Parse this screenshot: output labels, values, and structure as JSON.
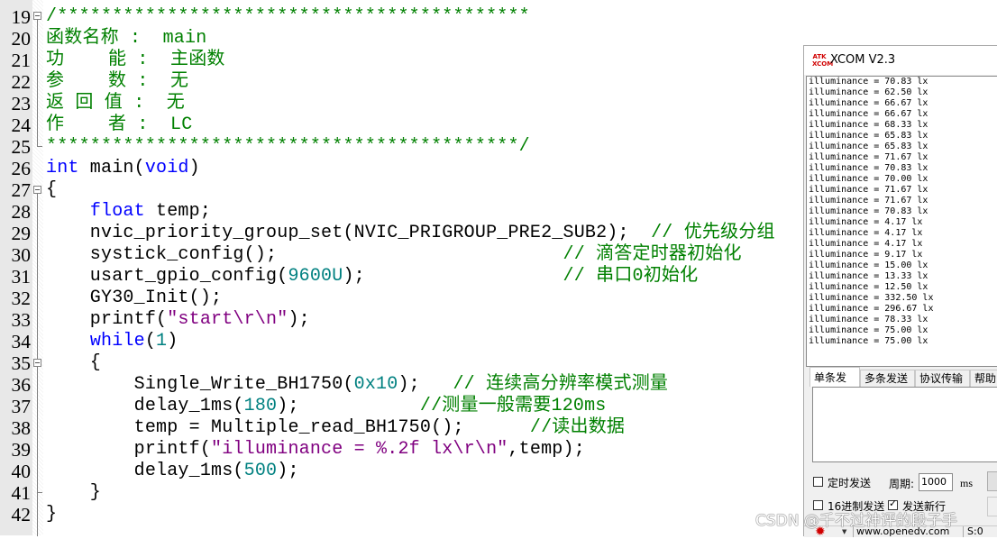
{
  "editor": {
    "lines": [
      {
        "num": "19",
        "parts": [
          {
            "t": "/*******************************************",
            "c": "cmt"
          }
        ]
      },
      {
        "num": "20",
        "parts": [
          {
            "t": "函数名称 :  main",
            "c": "cmt"
          }
        ]
      },
      {
        "num": "21",
        "parts": [
          {
            "t": "功    能 :  主函数",
            "c": "cmt"
          }
        ]
      },
      {
        "num": "22",
        "parts": [
          {
            "t": "参    数 :  无",
            "c": "cmt"
          }
        ]
      },
      {
        "num": "23",
        "parts": [
          {
            "t": "返 回 值 :  无",
            "c": "cmt"
          }
        ]
      },
      {
        "num": "24",
        "parts": [
          {
            "t": "作    者 :  LC",
            "c": "cmt"
          }
        ]
      },
      {
        "num": "25",
        "parts": [
          {
            "t": "*******************************************/",
            "c": "cmt"
          }
        ]
      },
      {
        "num": "26",
        "parts": [
          {
            "t": "int",
            "c": "kw"
          },
          {
            "t": " main(",
            "c": ""
          },
          {
            "t": "void",
            "c": "kw"
          },
          {
            "t": ")",
            "c": ""
          }
        ]
      },
      {
        "num": "27",
        "parts": [
          {
            "t": "{",
            "c": ""
          }
        ]
      },
      {
        "num": "28",
        "parts": [
          {
            "t": "    ",
            "c": ""
          },
          {
            "t": "float",
            "c": "kw"
          },
          {
            "t": " temp;",
            "c": ""
          }
        ]
      },
      {
        "num": "29",
        "parts": [
          {
            "t": "    nvic_priority_group_set(NVIC_PRIGROUP_PRE2_SUB2);  ",
            "c": ""
          },
          {
            "t": "// 优先级分组",
            "c": "cmt"
          }
        ]
      },
      {
        "num": "30",
        "parts": [
          {
            "t": "    systick_config();                          ",
            "c": ""
          },
          {
            "t": "// 滴答定时器初始化",
            "c": "cmt"
          }
        ]
      },
      {
        "num": "31",
        "parts": [
          {
            "t": "    usart_gpio_config(",
            "c": ""
          },
          {
            "t": "9600U",
            "c": "num"
          },
          {
            "t": ");                  ",
            "c": ""
          },
          {
            "t": "// 串口0初始化",
            "c": "cmt"
          }
        ]
      },
      {
        "num": "32",
        "parts": [
          {
            "t": "    GY30_Init();",
            "c": ""
          }
        ]
      },
      {
        "num": "33",
        "parts": [
          {
            "t": "    printf(",
            "c": ""
          },
          {
            "t": "\"start\\r\\n\"",
            "c": "str"
          },
          {
            "t": ");",
            "c": ""
          }
        ]
      },
      {
        "num": "34",
        "parts": [
          {
            "t": "    ",
            "c": ""
          },
          {
            "t": "while",
            "c": "kw"
          },
          {
            "t": "(",
            "c": ""
          },
          {
            "t": "1",
            "c": "num"
          },
          {
            "t": ")",
            "c": ""
          }
        ]
      },
      {
        "num": "35",
        "parts": [
          {
            "t": "    {",
            "c": ""
          }
        ]
      },
      {
        "num": "36",
        "parts": [
          {
            "t": "        Single_Write_BH1750(",
            "c": ""
          },
          {
            "t": "0x10",
            "c": "num"
          },
          {
            "t": ");   ",
            "c": ""
          },
          {
            "t": "// 连续高分辨率模式测量",
            "c": "cmt"
          }
        ]
      },
      {
        "num": "37",
        "parts": [
          {
            "t": "        delay_1ms(",
            "c": ""
          },
          {
            "t": "180",
            "c": "num"
          },
          {
            "t": ");           ",
            "c": ""
          },
          {
            "t": "//测量一般需要120ms",
            "c": "cmt"
          }
        ]
      },
      {
        "num": "38",
        "parts": [
          {
            "t": "        temp = Multiple_read_BH1750();      ",
            "c": ""
          },
          {
            "t": "//读出数据",
            "c": "cmt"
          }
        ]
      },
      {
        "num": "39",
        "parts": [
          {
            "t": "        printf(",
            "c": ""
          },
          {
            "t": "\"illuminance = %.2f lx\\r\\n\"",
            "c": "str"
          },
          {
            "t": ",temp);",
            "c": ""
          }
        ]
      },
      {
        "num": "40",
        "parts": [
          {
            "t": "        delay_1ms(",
            "c": ""
          },
          {
            "t": "500",
            "c": "num"
          },
          {
            "t": ");",
            "c": ""
          }
        ]
      },
      {
        "num": "41",
        "parts": [
          {
            "t": "    }",
            "c": ""
          }
        ]
      },
      {
        "num": "42",
        "parts": [
          {
            "t": "}",
            "c": ""
          }
        ]
      }
    ]
  },
  "xcom": {
    "title": "XCOM V2.3",
    "logo_top": "ATK",
    "logo_bottom": "XCOM",
    "received": [
      "illuminance = 70.83 lx",
      "illuminance = 62.50 lx",
      "illuminance = 66.67 lx",
      "illuminance = 66.67 lx",
      "illuminance = 68.33 lx",
      "illuminance = 65.83 lx",
      "illuminance = 65.83 lx",
      "illuminance = 71.67 lx",
      "illuminance = 70.83 lx",
      "illuminance = 70.00 lx",
      "illuminance = 71.67 lx",
      "illuminance = 71.67 lx",
      "illuminance = 70.83 lx",
      "illuminance = 4.17 lx",
      "illuminance = 4.17 lx",
      "illuminance = 4.17 lx",
      "illuminance = 9.17 lx",
      "illuminance = 15.00 lx",
      "illuminance = 13.33 lx",
      "illuminance = 12.50 lx",
      "illuminance = 332.50 lx",
      "illuminance = 296.67 lx",
      "illuminance = 78.33 lx",
      "illuminance = 75.00 lx",
      "illuminance = 75.00 lx"
    ],
    "tabs": [
      "单条发送",
      "多条发送",
      "协议传输",
      "帮助"
    ],
    "timed_send_label": "定时发送",
    "timed_send_checked": false,
    "period_label": "周期:",
    "period_value": "1000",
    "period_unit": "ms",
    "hex_send_label": "16进制发送",
    "hex_send_checked": false,
    "send_newline_label": "发送新行",
    "send_newline_checked": true,
    "status_url": "www.openedv.com",
    "status_sent": "S:0"
  },
  "watermark": "CSDN @千不过神评的段子手"
}
